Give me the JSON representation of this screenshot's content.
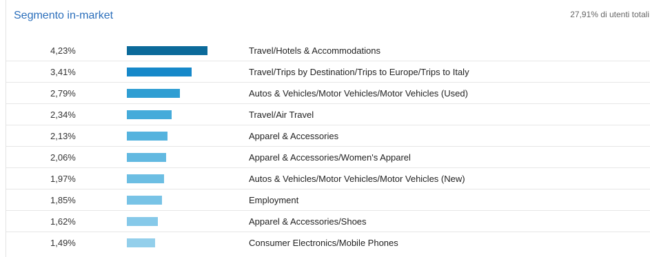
{
  "header": {
    "title": "Segmento in-market",
    "total": "27,91% di utenti totali"
  },
  "rows": [
    {
      "percent": "4,23%",
      "value": 4.23,
      "label": "Travel/Hotels & Accommodations",
      "color": "#0b6a9a"
    },
    {
      "percent": "3,41%",
      "value": 3.41,
      "label": "Travel/Trips by Destination/Trips to Europe/Trips to Italy",
      "color": "#1688c9"
    },
    {
      "percent": "2,79%",
      "value": 2.79,
      "label": "Autos & Vehicles/Motor Vehicles/Motor Vehicles (Used)",
      "color": "#2f9ed3"
    },
    {
      "percent": "2,34%",
      "value": 2.34,
      "label": "Travel/Air Travel",
      "color": "#45abda"
    },
    {
      "percent": "2,13%",
      "value": 2.13,
      "label": "Apparel & Accessories",
      "color": "#55b3de"
    },
    {
      "percent": "2,06%",
      "value": 2.06,
      "label": "Apparel & Accessories/Women's Apparel",
      "color": "#62b9e1"
    },
    {
      "percent": "1,97%",
      "value": 1.97,
      "label": "Autos & Vehicles/Motor Vehicles/Motor Vehicles (New)",
      "color": "#6cbee3"
    },
    {
      "percent": "1,85%",
      "value": 1.85,
      "label": "Employment",
      "color": "#78c3e6"
    },
    {
      "percent": "1,62%",
      "value": 1.62,
      "label": "Apparel & Accessories/Shoes",
      "color": "#86c9e9"
    },
    {
      "percent": "1,49%",
      "value": 1.49,
      "label": "Consumer Electronics/Mobile Phones",
      "color": "#93cfeb"
    }
  ]
}
